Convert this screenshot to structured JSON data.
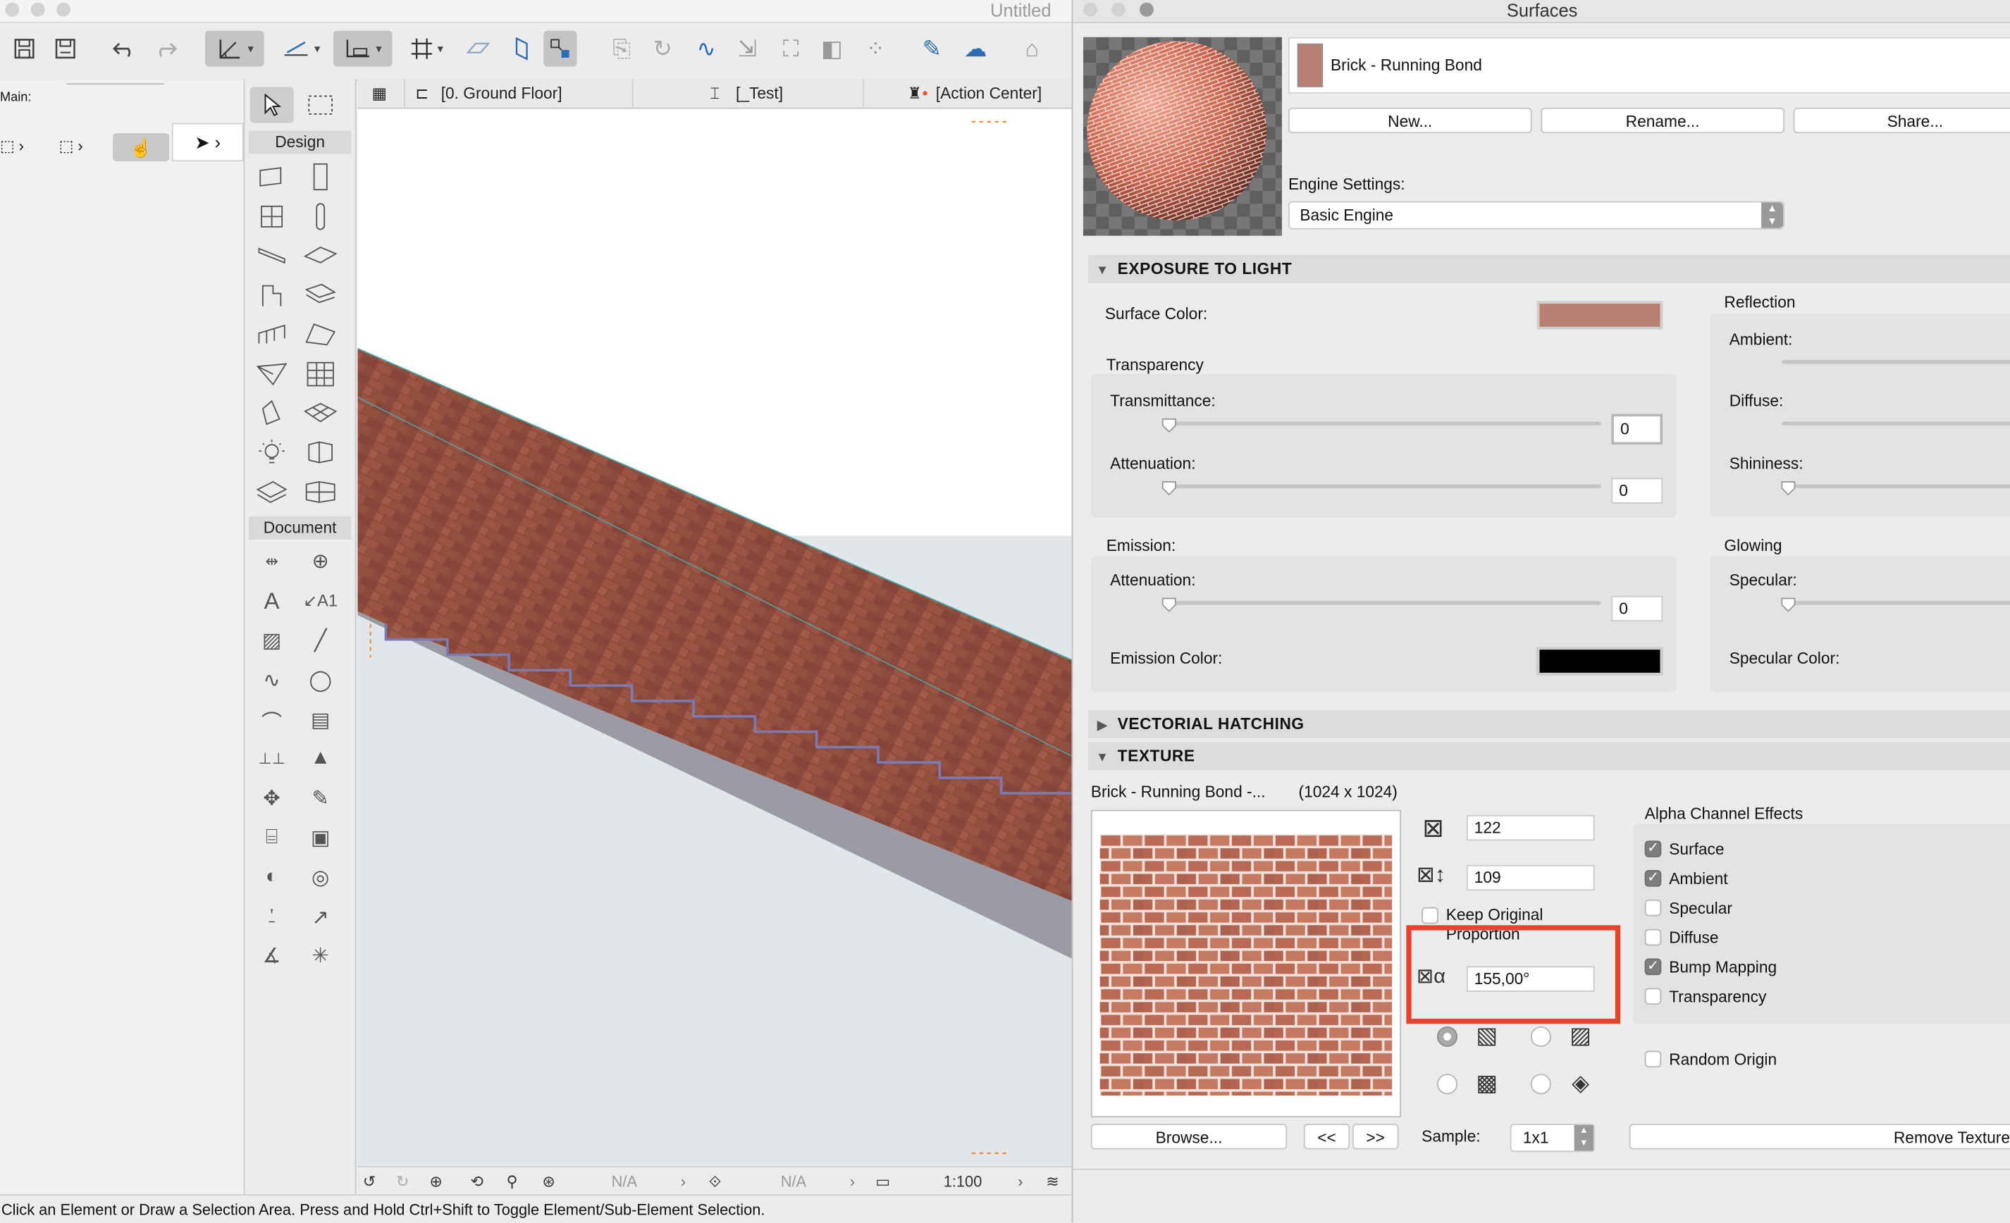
{
  "window": {
    "title": "Untitled"
  },
  "left_panel": {
    "main_label": "Main:"
  },
  "toolbox": {
    "design_header": "Design",
    "document_header": "Document"
  },
  "tabs": [
    {
      "label": "[0. Ground Floor]",
      "icon": "floor-plan-icon"
    },
    {
      "label": "[_Test]",
      "icon": "section-icon"
    },
    {
      "label": "[Action Center]",
      "icon": "action-center-icon"
    }
  ],
  "view_status": {
    "layer": "N/A",
    "pen": "N/A",
    "scale": "1:100"
  },
  "status_bar": {
    "text": "Click an Element or Draw a Selection Area. Press and Hold Ctrl+Shift to Toggle Element/Sub-Element Selection."
  },
  "surfaces": {
    "title": "Surfaces",
    "surface_name": "Brick - Running Bond",
    "buttons": {
      "new": "New...",
      "rename": "Rename...",
      "share": "Share..."
    },
    "engine_settings_label": "Engine Settings:",
    "engine_value": "Basic Engine",
    "sections": {
      "exposure": "EXPOSURE TO LIGHT",
      "hatching": "VECTORIAL HATCHING",
      "texture": "TEXTURE"
    },
    "exposure": {
      "surface_color_label": "Surface Color:",
      "surface_color": "#b97f73",
      "transparency_label": "Transparency",
      "transmittance_label": "Transmittance:",
      "transmittance_value": "0",
      "attenuation_label": "Attenuation:",
      "attenuation_value": "0",
      "emission_label": "Emission:",
      "emission_attenuation_label": "Attenuation:",
      "emission_attenuation_value": "0",
      "emission_color_label": "Emission Color:",
      "emission_color": "#000000",
      "reflection_label": "Reflection",
      "ambient_label": "Ambient:",
      "diffuse_label": "Diffuse:",
      "shininess_label": "Shininess:",
      "glowing_label": "Glowing",
      "specular_label": "Specular:",
      "specular_color_label": "Specular Color:"
    },
    "texture": {
      "name": "Brick - Running Bond -...",
      "resolution": "(1024 x 1024)",
      "width_value": "122",
      "height_value": "109",
      "keep_proportion_label": "Keep Original Proportion",
      "angle_value": "155,00°",
      "browse": "Browse...",
      "prev": "<<",
      "next": ">>",
      "sample_label": "Sample:",
      "sample_value": "1x1",
      "remove": "Remove Texture",
      "alpha_title": "Alpha Channel Effects",
      "alpha_options": [
        {
          "label": "Surface",
          "checked": true
        },
        {
          "label": "Ambient",
          "checked": true
        },
        {
          "label": "Specular",
          "checked": false
        },
        {
          "label": "Diffuse",
          "checked": false
        },
        {
          "label": "Bump Mapping",
          "checked": true
        },
        {
          "label": "Transparency",
          "checked": false
        }
      ],
      "random_origin_label": "Random Origin",
      "highlight_color": "#e8412c"
    }
  }
}
